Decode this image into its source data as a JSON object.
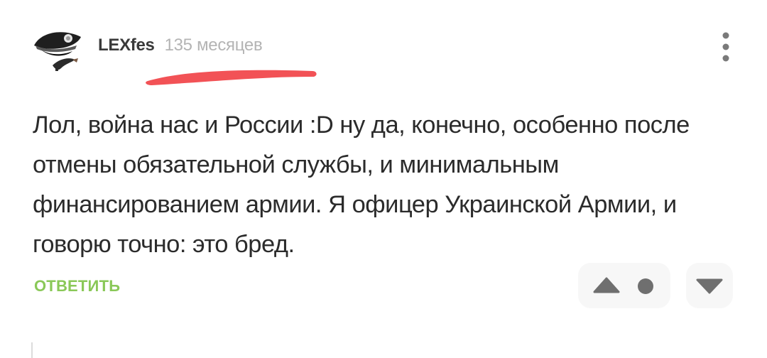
{
  "comment": {
    "username": "LEXfes",
    "timestamp": "135 месяцев",
    "text": "Лол, война нас и России :D ну да, конечно, особенно после отмены обязательной службы, и минимальным финансированием армии. Я офицер Украинской Армии, и говорю точно: это бред.",
    "reply_label": "ОТВЕТИТЬ"
  },
  "icons": {
    "avatar": "police-cap-avatar",
    "menu": "more-vertical-icon",
    "upvote": "triangle-up-icon",
    "score": "dot-icon",
    "downvote": "triangle-down-icon"
  },
  "colors": {
    "reply": "#8ac858",
    "redaction": "#f25256",
    "vote_bg": "#f7f7f7",
    "icon": "#6f6f6f"
  }
}
